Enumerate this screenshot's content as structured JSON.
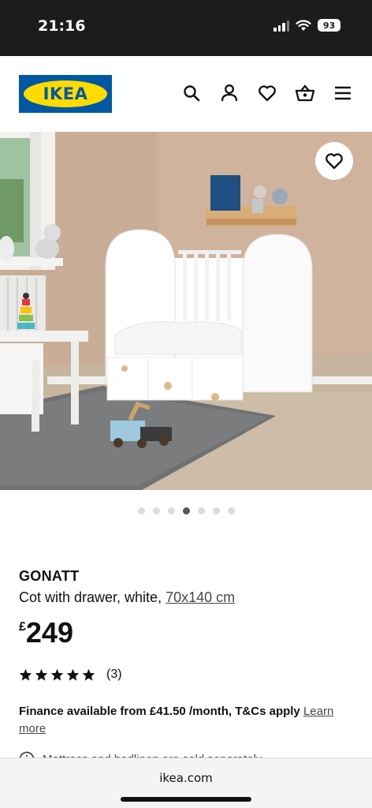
{
  "status_bar": {
    "time": "21:16",
    "battery": "93"
  },
  "header": {
    "logo_text": "IKEA",
    "icons": [
      "search-icon",
      "user-icon",
      "heart-icon",
      "basket-icon",
      "menu-icon"
    ],
    "brand_colors": {
      "blue": "#0058a3",
      "yellow": "#ffdb00"
    }
  },
  "gallery": {
    "dot_count": 7,
    "active_index": 3
  },
  "product": {
    "name": "GONATT",
    "description": "Cot with drawer, white,",
    "size_link": "70x140 cm",
    "price_currency": "£",
    "price_amount": "249",
    "rating_stars": 5,
    "review_count": "(3)",
    "finance_text": "Finance available from £41.50 /month, T&Cs apply",
    "finance_link": "Learn more",
    "notice_text": "Mattress and bedlinen are sold separately"
  },
  "browser": {
    "url": "ikea.com"
  }
}
